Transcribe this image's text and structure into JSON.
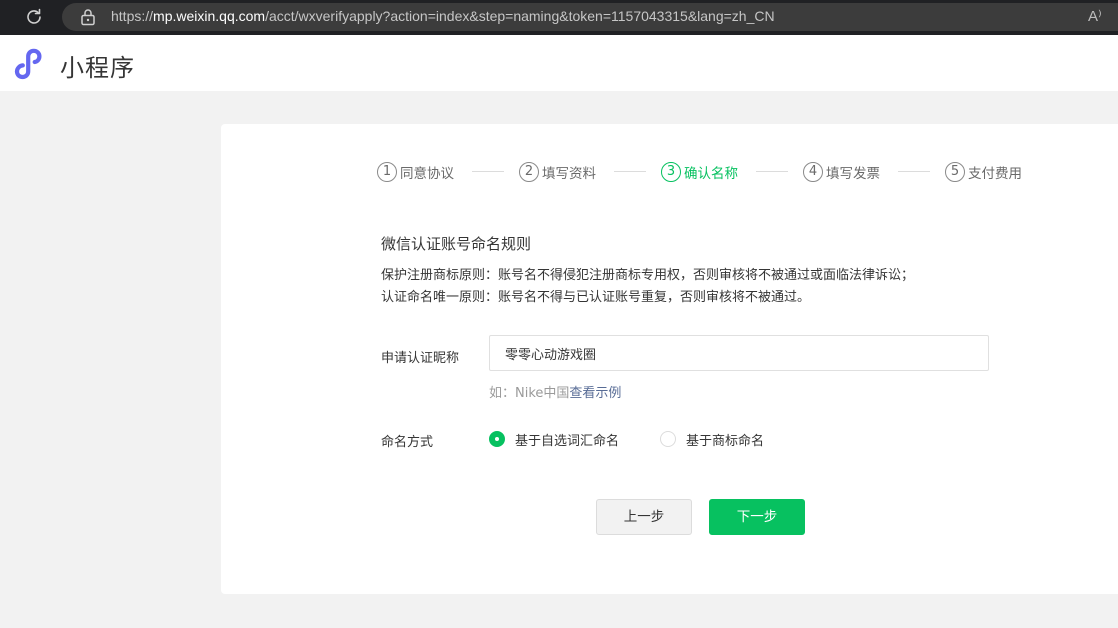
{
  "browser": {
    "url_scheme": "https://",
    "url_host": "mp.weixin.qq.com",
    "url_path": "/acct/wxverifyapply?action=index&step=naming&token=1157043315&lang=zh_CN",
    "read_aloud_label": "A⁾"
  },
  "header": {
    "title": "小程序",
    "brand_color": "#6467f0"
  },
  "steps": [
    {
      "num": "1",
      "label": "同意协议",
      "active": false
    },
    {
      "num": "2",
      "label": "填写资料",
      "active": false
    },
    {
      "num": "3",
      "label": "确认名称",
      "active": true
    },
    {
      "num": "4",
      "label": "填写发票",
      "active": false
    },
    {
      "num": "5",
      "label": "支付费用",
      "active": false
    }
  ],
  "rules": {
    "title": "微信认证账号命名规则",
    "line1": "保护注册商标原则：账号名不得侵犯注册商标专用权，否则审核将不被通过或面临法律诉讼；",
    "line2": "认证命名唯一原则：账号名不得与已认证账号重复，否则审核将不被通过。"
  },
  "form": {
    "nickname_label": "申请认证昵称",
    "nickname_value": "零零心动游戏圈",
    "hint_prefix": "如：Nike中国",
    "hint_link": "查看示例",
    "naming_label": "命名方式",
    "naming_options": [
      {
        "label": "基于自选词汇命名",
        "checked": true
      },
      {
        "label": "基于商标命名",
        "checked": false
      }
    ]
  },
  "buttons": {
    "prev": "上一步",
    "next": "下一步"
  },
  "colors": {
    "accent": "#07c160",
    "link": "#576b95"
  }
}
